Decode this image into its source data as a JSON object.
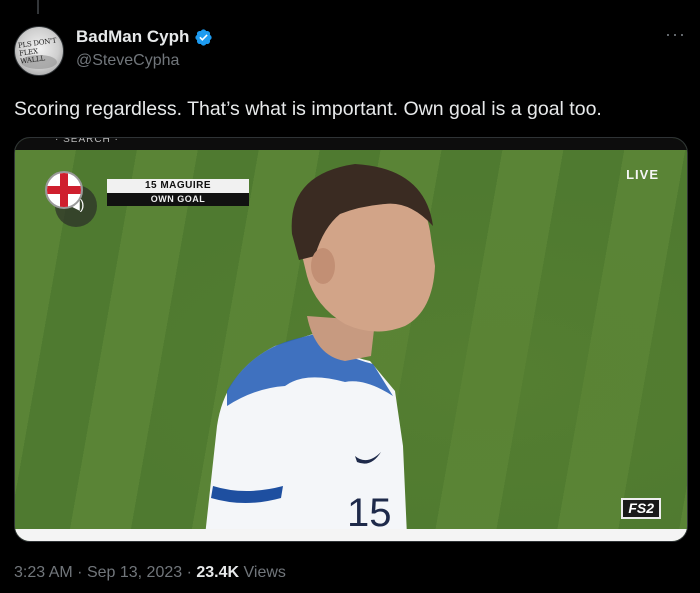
{
  "author": {
    "display_name": "BadMan Cyph",
    "handle": "@SteveCypha",
    "verified": true,
    "avatar_scribble": [
      "PLS DON'T",
      "FLEX",
      "WALLL"
    ]
  },
  "more_label": "···",
  "tweet_text": "Scoring regardless. That’s what is important.  Own goal is a goal too.",
  "media": {
    "broadcast_top_text": "· SEARCH ·",
    "scorebug_name": "15 MAGUIRE",
    "scorebug_event": "OWN GOAL",
    "live_label": "LIVE",
    "channel_logo": "FS2",
    "shirt_number": "15"
  },
  "footer": {
    "time": "3:23 AM",
    "separator": "·",
    "date": "Sep 13, 2023",
    "views_count": "23.4K",
    "views_label": "Views"
  },
  "colors": {
    "background": "#000000",
    "verified_blue": "#1d9bf0",
    "muted_text": "#71767b",
    "pitch_green": "#5a8436"
  }
}
